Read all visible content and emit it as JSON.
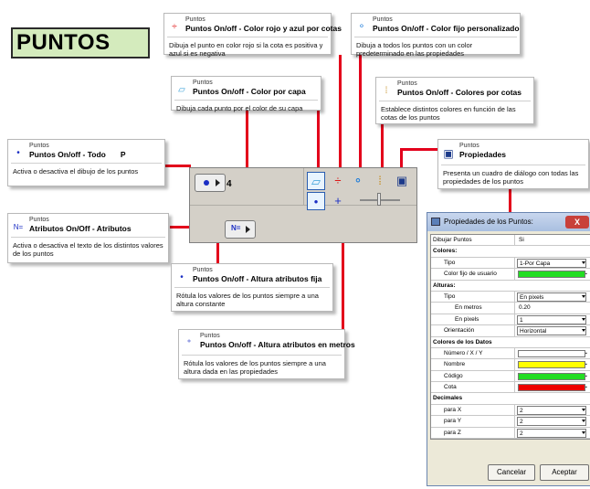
{
  "page": {
    "title": "PUNTOS"
  },
  "tooltips": [
    {
      "key": "todo",
      "category": "Puntos",
      "title": "Puntos On/off - Todo",
      "shortcut": "P",
      "body": "Activa o desactiva el dibujo de los puntos"
    },
    {
      "key": "rojo_azul",
      "category": "Puntos",
      "title": "Puntos On/off - Color rojo y azul por cotas",
      "body": "Dibuja el punto en color rojo si la cota es positiva y azul si es negativa"
    },
    {
      "key": "fijo",
      "category": "Puntos",
      "title": "Puntos On/off - Color fijo personalizado",
      "body": "Dibuja a todos los puntos con un color predeterminado en las propiedades"
    },
    {
      "key": "capa",
      "category": "Puntos",
      "title": "Puntos On/off - Color por capa",
      "body": "Dibuja cada punto por el color de su capa"
    },
    {
      "key": "cotas",
      "category": "Puntos",
      "title": "Puntos On/off - Colores por cotas",
      "body": "Establece distintos colores en función de las cotas de los puntos"
    },
    {
      "key": "propiedades",
      "category": "Puntos",
      "title": "Propiedades",
      "body": "Presenta un cuadro de diálogo con todas las propiedades de los puntos"
    },
    {
      "key": "atributos",
      "category": "Puntos",
      "title": "Atributos On/Off - Atributos",
      "body": "Activa o desactiva el texto de los distintos valores de los puntos"
    },
    {
      "key": "altura_fija",
      "category": "Puntos",
      "title": "Puntos On/off - Altura atributos fija",
      "body": "Rótula los valores de los puntos  siempre a una altura constante"
    },
    {
      "key": "altura_metros",
      "category": "Puntos",
      "title": "Puntos On/off - Altura atributos en metros",
      "body": "Rótula los valores de los puntos  siempre a una altura dada en las propiedades"
    }
  ],
  "toolbar": {
    "count_label": "4"
  },
  "dialog": {
    "title": "Propiedades de los Puntos:",
    "close_label": "X",
    "rows": [
      {
        "label": "Dibujar Puntos",
        "value": "Si",
        "kind": "text"
      },
      {
        "label": "Colores:",
        "kind": "section"
      },
      {
        "label": "Tipo",
        "value": "1-Por Capa",
        "kind": "select",
        "indent": 1
      },
      {
        "label": "Color fijo de usuario",
        "color": "#22dd22",
        "kind": "color",
        "indent": 1
      },
      {
        "label": "Alturas:",
        "kind": "section"
      },
      {
        "label": "Tipo",
        "value": "En pixels",
        "kind": "select",
        "indent": 1
      },
      {
        "label": "En metros",
        "value": "0.20",
        "kind": "text",
        "indent": 2
      },
      {
        "label": "En pixels",
        "value": "1",
        "kind": "select",
        "indent": 2
      },
      {
        "label": "Orientación",
        "value": "Horizontal",
        "kind": "select",
        "indent": 1
      },
      {
        "label": "Colores de los Datos",
        "kind": "section"
      },
      {
        "label": "Número / X / Y",
        "color": "#ffffff",
        "kind": "color",
        "indent": 1
      },
      {
        "label": "Nombre",
        "color": "#ffff00",
        "kind": "color",
        "indent": 1
      },
      {
        "label": "Código",
        "color": "#22dd22",
        "kind": "color",
        "indent": 1
      },
      {
        "label": "Cota",
        "color": "#ee0000",
        "kind": "color",
        "indent": 1
      },
      {
        "label": "Decimales",
        "kind": "section"
      },
      {
        "label": "para X",
        "value": "2",
        "kind": "select",
        "indent": 1
      },
      {
        "label": "para Y",
        "value": "2",
        "kind": "select",
        "indent": 1
      },
      {
        "label": "para Z",
        "value": "2",
        "kind": "select",
        "indent": 1
      }
    ],
    "cancel_label": "Cancelar",
    "ok_label": "Aceptar"
  },
  "colors": {
    "connector": "#e3001b",
    "title_bg": "#d4ebbd",
    "toolbar_bg": "#d4d0c8"
  }
}
